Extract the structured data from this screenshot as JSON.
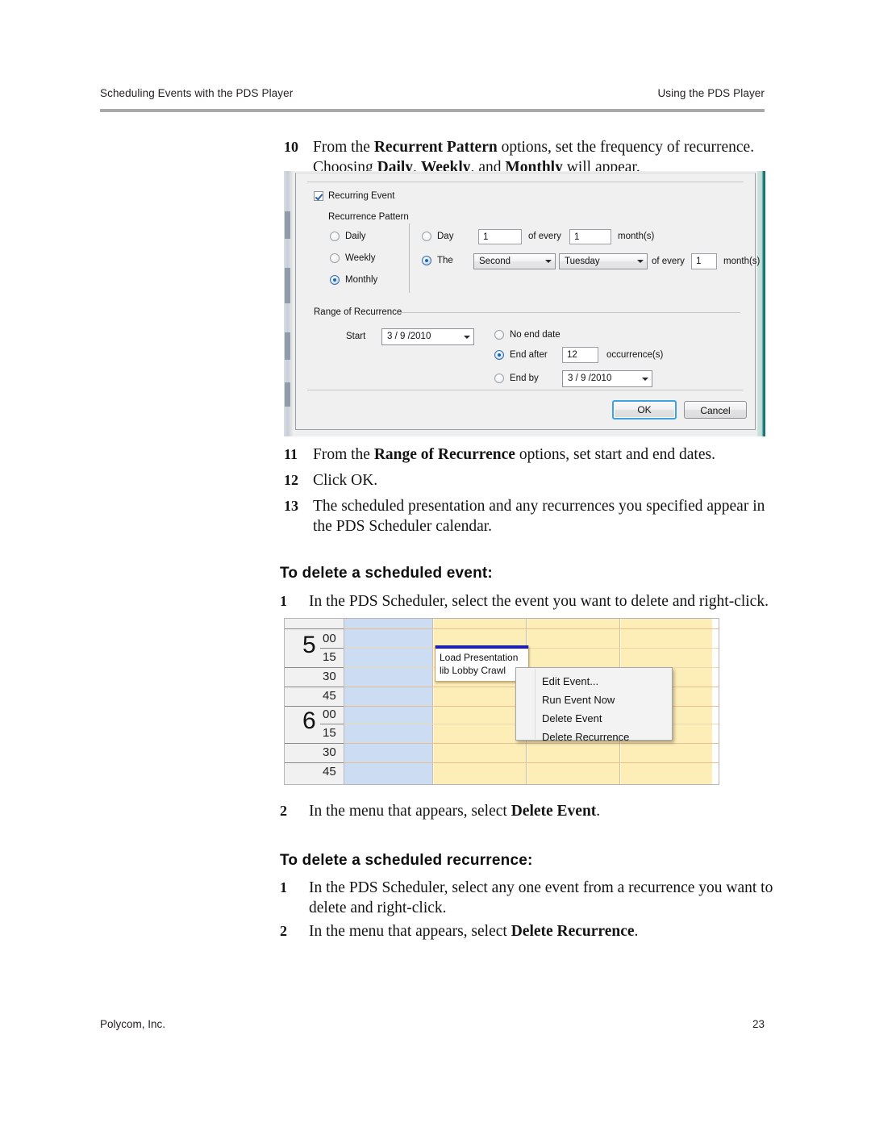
{
  "header": {
    "left": "Scheduling Events with the PDS Player",
    "right": "Using the PDS Player"
  },
  "footer": {
    "left": "Polycom, Inc.",
    "page_number": "23"
  },
  "steps_top": [
    {
      "num": "10",
      "text_parts": [
        "From the ",
        "Recurrent Pattern",
        " options, set the frequency of recurrence. Choosing ",
        "Daily",
        ", ",
        "Weekly",
        ", and ",
        "Monthly",
        " will appear."
      ]
    }
  ],
  "steps_mid": [
    {
      "num": "11",
      "text": "From the Range of Recurrence options, set start and end dates."
    },
    {
      "num": "12",
      "text": "Click OK."
    },
    {
      "num": "13",
      "text": "The scheduled presentation and any recurrences you specified appear in the PDS Scheduler calendar."
    }
  ],
  "section_delete_event": {
    "heading": "To delete a scheduled event:",
    "step1_num": "1",
    "step1_text": "In the PDS Scheduler, select the event you want to delete and right-click.",
    "step2_num": "2",
    "step2_text": "In the menu that appears, select Delete Event."
  },
  "section_delete_recurrence": {
    "heading": "To delete a scheduled recurrence:",
    "step1_num": "1",
    "step1_text": "In the PDS Scheduler, select any one event from a recurrence you want to delete and right-click.",
    "step2_num": "2",
    "step2_text": "In the menu that appears, select Delete Recurrence."
  },
  "recurrence_dialog": {
    "recurring_event_checkbox": {
      "label": "Recurring Event",
      "checked": true
    },
    "recurrence_pattern": {
      "group_title": "Recurrence Pattern",
      "frequency_options": [
        {
          "label": "Daily",
          "selected": false
        },
        {
          "label": "Weekly",
          "selected": false
        },
        {
          "label": "Monthly",
          "selected": true
        }
      ],
      "day_row": {
        "radio_label": "Day",
        "selected": false,
        "day_value": "1",
        "of_every_label": "of every",
        "interval_value": "1",
        "unit_label": "month(s)"
      },
      "the_row": {
        "radio_label": "The",
        "selected": true,
        "ordinal_value": "Second",
        "weekday_value": "Tuesday",
        "of_every_label": "of every",
        "interval_value": "1",
        "unit_label": "month(s)"
      }
    },
    "range_of_recurrence": {
      "group_title": "Range of Recurrence",
      "start_label": "Start",
      "start_value": "3 / 9 /2010",
      "no_end_date": {
        "label": "No end date",
        "selected": false
      },
      "end_after": {
        "label": "End after",
        "selected": true,
        "value": "12",
        "unit_label": "occurrence(s)"
      },
      "end_by": {
        "label": "End by",
        "selected": false,
        "value": "3 / 9 /2010"
      }
    },
    "buttons": {
      "ok": "OK",
      "cancel": "Cancel"
    }
  },
  "calendar": {
    "hours": [
      {
        "hour": "5",
        "minutes": [
          "00",
          "15",
          "30",
          "45"
        ]
      },
      {
        "hour": "6",
        "minutes": [
          "00",
          "15",
          "30",
          "45"
        ]
      }
    ],
    "event": {
      "title": "Load Presentation",
      "subtitle": "lib Lobby Crawl"
    },
    "context_menu": [
      "Edit Event...",
      "Run Event Now",
      "Delete Event",
      "Delete Recurrence"
    ],
    "colors": {
      "selected_column": "#ccdcf2",
      "event_column": "#fdeeb8",
      "event_accent_bar": "#1c1fb0"
    }
  }
}
